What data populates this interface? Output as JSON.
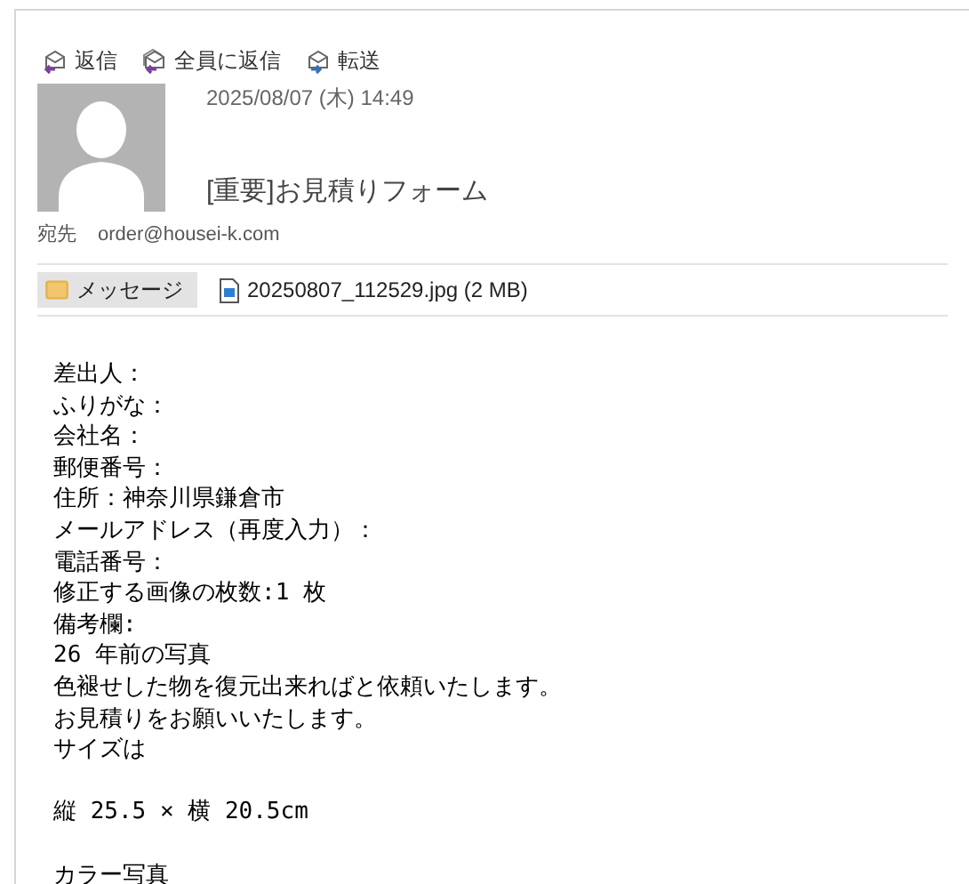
{
  "toolbar": [
    {
      "kind": "reply",
      "label": "返信"
    },
    {
      "kind": "reply_all",
      "label": "全員に返信"
    },
    {
      "kind": "forward",
      "label": "転送"
    }
  ],
  "header": {
    "date": "2025/08/07 (木) 14:49",
    "subject": "[重要]お見積りフォーム",
    "to_label": "宛先",
    "to": "order@housei-k.com"
  },
  "attachments": [
    {
      "kind": "message",
      "label": "メッセージ",
      "selected": true
    },
    {
      "kind": "file",
      "label": "20250807_112529.jpg (2 MB)",
      "selected": false
    }
  ],
  "body": [
    [
      "差出人：",
      "ふりがな：",
      "会社名：",
      "郵便番号：",
      "住所：神奈川県鎌倉市",
      "メールアドレス（再度入力）：",
      "電話番号：",
      "修正する画像の枚数:1 枚",
      "備考欄:",
      "26 年前の写真",
      "色褪せした物を復元出来ればと依頼いたします。",
      "お見積りをお願いいたします。",
      "サイズは"
    ],
    [
      "縦 25.5 × 横 20.5cm"
    ],
    [
      "カラー写真"
    ]
  ]
}
